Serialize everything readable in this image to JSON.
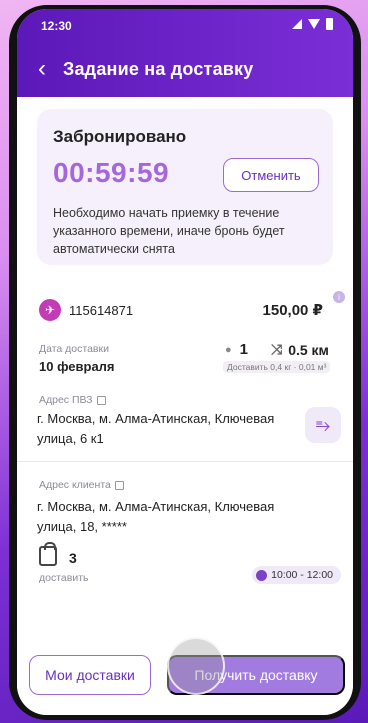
{
  "status_bar": {
    "time": "12:30"
  },
  "header": {
    "title": "Задание на доставку"
  },
  "booking": {
    "title": "Забронировано",
    "timer": "00:59:59",
    "cancel_label": "Отменить",
    "note": "Необходимо начать приемку в течение указанного времени, иначе бронь будет автоматически снята"
  },
  "order": {
    "number": "115614871",
    "price": "150,00 ₽",
    "date_label": "Дата доставки",
    "date_value": "10 февраля",
    "quantity": "1",
    "distance": "0.5 км",
    "weight_note": "Доставить 0,4 кг · 0,01 м³"
  },
  "pickup": {
    "label": "Адрес ПВЗ",
    "address": "г. Москва, м. Алма-Атинская, Ключевая улица, 6 к1"
  },
  "client": {
    "label": "Адрес клиента",
    "address": "г. Москва, м. Алма-Атинская, Ключевая улица, 18, *****"
  },
  "delivery": {
    "count": "3",
    "count_label": "доставить",
    "time_window": "10:00 - 12:00"
  },
  "actions": {
    "my_deliveries": "Мои доставки",
    "get_delivery": "Получить доставку"
  },
  "colors": {
    "brand": "#6a2fbf",
    "accent_timer": "#a467dc",
    "order_icon": "#c43bb6"
  }
}
